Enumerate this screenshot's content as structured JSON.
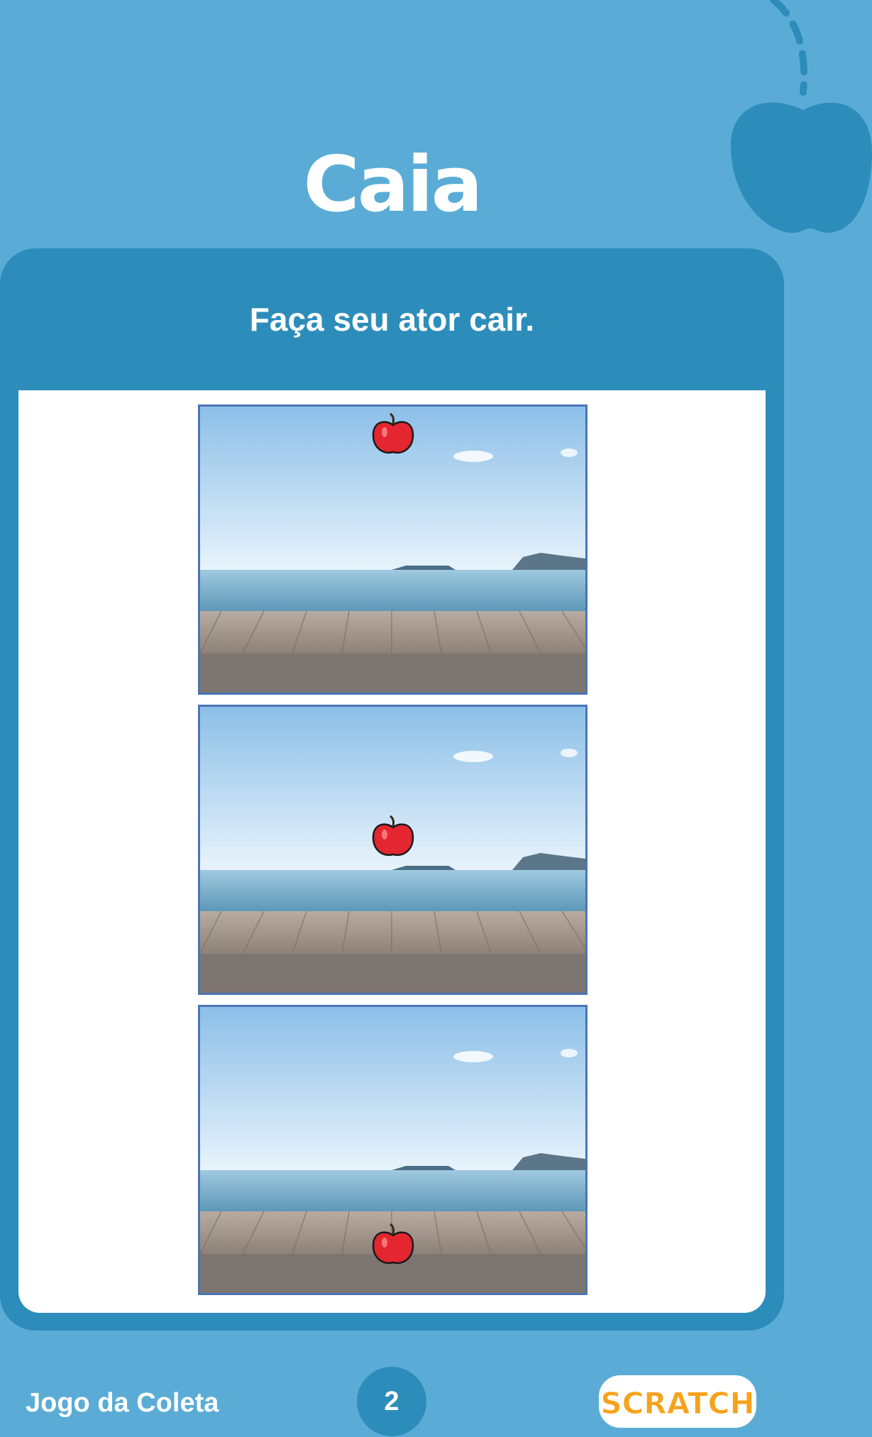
{
  "header": {
    "title": "Caia"
  },
  "card": {
    "instruction": "Faça seu ator cair."
  },
  "steps": [
    {
      "description": "apple at top of stage"
    },
    {
      "description": "apple falling, middle of stage"
    },
    {
      "description": "apple at bottom of stage"
    }
  ],
  "footer": {
    "project_name": "Jogo da Coleta",
    "page_number": "2",
    "logo_text": "SCRATCH"
  },
  "colors": {
    "page_background": "#5aacd6",
    "card": "#2d8dba",
    "frame_border": "#4a74b8",
    "apple": "#e3262f",
    "logo": "#f7a21b"
  }
}
